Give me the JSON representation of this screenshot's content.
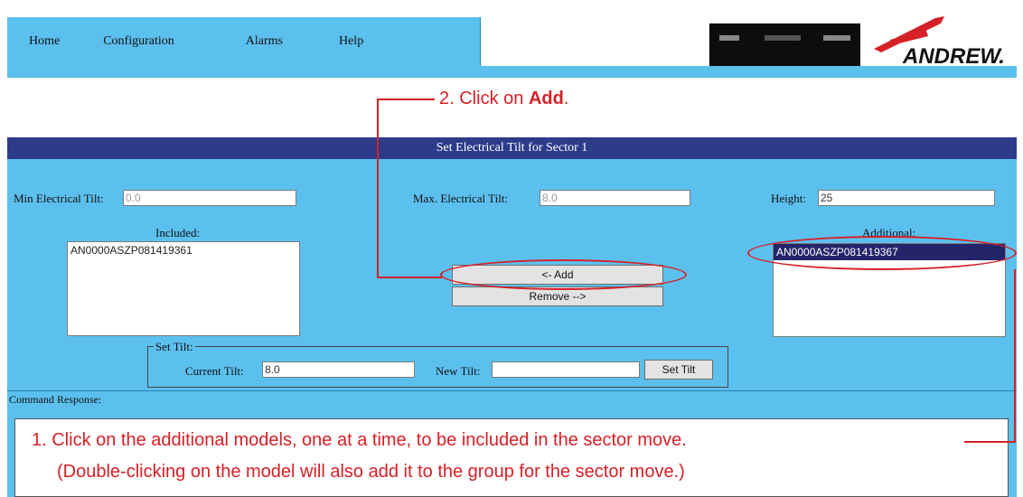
{
  "nav": {
    "items": [
      "Home",
      "Configuration",
      "Alarms",
      "Help"
    ]
  },
  "logo": {
    "text": "ANDREW."
  },
  "section": {
    "title": "Set Electrical Tilt for Sector 1"
  },
  "fields": {
    "min_tilt": {
      "label": "Min Electrical Tilt:",
      "value": "0.0"
    },
    "max_tilt": {
      "label": "Max. Electrical Tilt:",
      "value": "8.0"
    },
    "height": {
      "label": "Height:",
      "value": "25"
    }
  },
  "included": {
    "label": "Included:",
    "items": [
      "AN0000ASZP081419361"
    ]
  },
  "additional": {
    "label": "Additional:",
    "items": [
      "AN0000ASZP081419367"
    ]
  },
  "buttons": {
    "add": "<- Add",
    "remove": "Remove -->",
    "set_tilt": "Set Tilt"
  },
  "set_tilt": {
    "legend": "Set Tilt:",
    "current_label": "Current Tilt:",
    "current_value": "8.0",
    "new_label": "New Tilt:",
    "new_value": ""
  },
  "command": {
    "label": "Command Response:"
  },
  "callouts": {
    "step2_prefix": "2.  Click on ",
    "step2_bold": "Add",
    "step2_suffix": ".",
    "step1_line1": "1.  Click on the additional models, one at a time, to be included in the sector move.",
    "step1_line2": "(Double-clicking on the model will also add it to the group for the sector move.)"
  },
  "colors": {
    "panel_blue": "#5cc0ee",
    "header_navy": "#2c3b8a",
    "callout_red": "#d62027",
    "selection_navy": "#24246a"
  }
}
